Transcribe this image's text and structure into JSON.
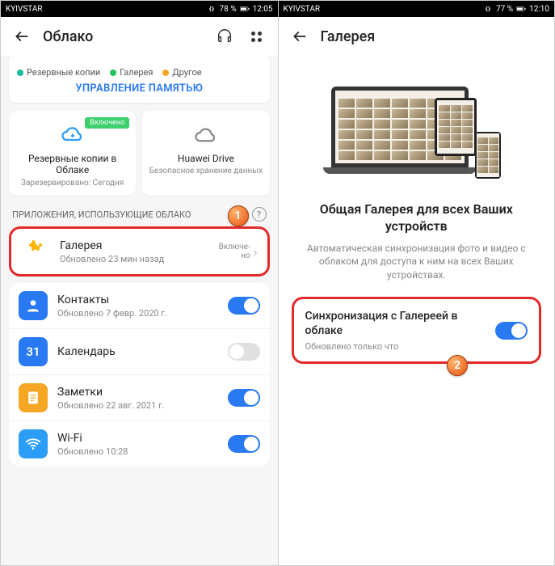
{
  "statusbar": {
    "carrier": "KYIVSTAR",
    "battery1": "78 %",
    "time1": "12:05",
    "battery2": "77 %",
    "time2": "12:10"
  },
  "phone1": {
    "title": "Облако",
    "legend": {
      "backups": "Резервные копии",
      "gallery": "Галерея",
      "other": "Другое"
    },
    "memory_link": "УПРАВЛЕНИЕ ПАМЯТЬЮ",
    "backup_badge": "Включено",
    "backup_title": "Резервные копии в Облаке",
    "backup_sub": "Зарезервировано: Сегодня",
    "drive_title": "Huawei Drive",
    "drive_sub": "Безопасное хранение данных",
    "section": "ПРИЛОЖЕНИЯ, ИСПОЛЬЗУЮЩИЕ ОБЛАКО",
    "step1": "1",
    "apps": [
      {
        "name": "Галерея",
        "sub": "Обновлено 23 мин назад",
        "status": "Включе-\nно"
      },
      {
        "name": "Контакты",
        "sub": "Обновлено 7 февр. 2020 г."
      },
      {
        "name": "Календарь",
        "sub": ""
      },
      {
        "name": "Заметки",
        "sub": "Обновлено 22 авг. 2021 г."
      },
      {
        "name": "Wi-Fi",
        "sub": "Обновлено 10:28"
      }
    ]
  },
  "phone2": {
    "title": "Галерея",
    "hero_title": "Общая Галерея для всех Ваших устройств",
    "hero_desc": "Автоматическая синхронизация фото и видео с облаком для доступа к ним на всех Ваших устройствах.",
    "sync_title": "Синхронизация с Галереей в облаке",
    "sync_sub": "Обновлено только что",
    "step2": "2"
  }
}
